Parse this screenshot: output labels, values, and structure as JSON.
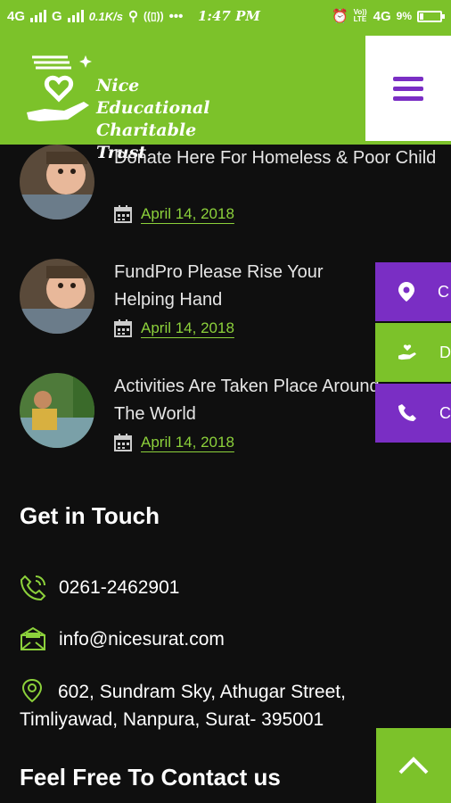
{
  "status_bar": {
    "network_left": "4G",
    "network_mid": "G",
    "speed": "0.1K/s",
    "time": "1:47 PM",
    "volte": "Vo)) LTE",
    "network_right": "4G",
    "battery": "9%"
  },
  "header": {
    "logo_line1": "Nice Educational",
    "logo_line2": "Charitable Trust"
  },
  "posts": [
    {
      "title": "Donate Here For Homeless & Poor Child",
      "date": "April 14, 2018"
    },
    {
      "title": "FundPro Please Rise Your Helping Hand",
      "date": "April 14, 2018"
    },
    {
      "title": "Activities Are Taken Place Around The World",
      "date": "April 14, 2018"
    }
  ],
  "side_buttons": [
    {
      "icon": "location-icon",
      "label": "C"
    },
    {
      "icon": "donate-hand-icon",
      "label": "D"
    },
    {
      "icon": "phone-icon",
      "label": "C"
    }
  ],
  "contact": {
    "heading": "Get in Touch",
    "phone": "0261-2462901",
    "email": "info@nicesurat.com",
    "address": "602, Sundram Sky, Athugar Street, Timliyawad, Nanpura, Surat- 395001"
  },
  "footer": {
    "heading": "Feel Free To Contact us"
  },
  "colors": {
    "accent_green": "#7cc22a",
    "accent_purple": "#7a2ec4",
    "background": "#0f0f0f"
  }
}
